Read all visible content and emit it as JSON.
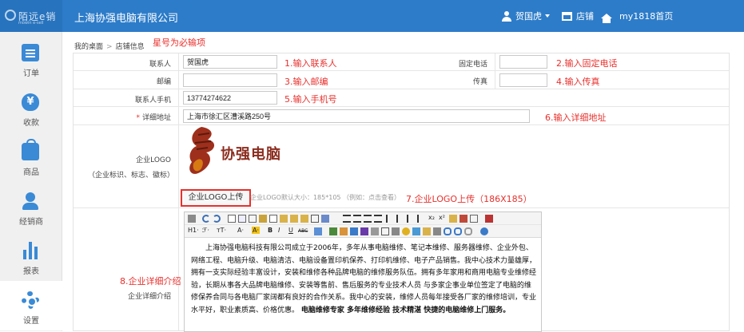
{
  "brand": {
    "logo_text": "陌远e销",
    "logo_sub": "mowin e-sell"
  },
  "header": {
    "company": "上海协强电脑有限公司",
    "user": "贺国虎",
    "store": "店铺",
    "home": "my1818首页"
  },
  "sidebar": {
    "items": [
      {
        "label": "订单",
        "icon": "order-icon"
      },
      {
        "label": "收款",
        "icon": "money-bag-icon"
      },
      {
        "label": "商品",
        "icon": "shopping-bag-icon"
      },
      {
        "label": "经销商",
        "icon": "person-icon"
      },
      {
        "label": "报表",
        "icon": "bar-chart-icon"
      },
      {
        "label": "设置",
        "icon": "gear-icon"
      }
    ]
  },
  "breadcrumb": {
    "home": "我的桌面",
    "sep": ">",
    "current": "店铺信息"
  },
  "annotations": {
    "required_note": "星号为必输项",
    "a1": "1.输入联系人",
    "a2": "2.输入固定电话",
    "a3": "3.输入邮编",
    "a4": "4.输入传真",
    "a5": "5.输入手机号",
    "a6": "6.输入详细地址",
    "a7": "7.企业LOGO上传（186X185）",
    "a8": "8.企业详细介绍"
  },
  "form": {
    "contact_label": "联系人",
    "contact_value": "贺国虎",
    "phone_label": "固定电话",
    "phone_value": "",
    "zip_label": "邮编",
    "zip_value": "",
    "fax_label": "传真",
    "fax_value": "",
    "mobile_label": "联系人手机",
    "mobile_value": "13774274622",
    "address_label": "详细地址",
    "address_value": "上海市徐汇区漕溪路250号",
    "logo_label": "企业LOGO",
    "logo_sublabel": "（企业标识、标志、徽标）",
    "logo_image_text": "协强电脑",
    "upload_button": "企业LOGO上传",
    "upload_hint": "企业LOGO默认大小：185*105 （例如：点击查看）",
    "intro_label": "企业详细介绍"
  },
  "editor": {
    "toolbar_text": [
      "H1·",
      "ℱ·",
      "тT·",
      "A·",
      "A·",
      "B",
      "I",
      "U",
      "ABC"
    ],
    "paragraph": "上海协强电脑科技有限公司成立于2006年，多年从事电脑维修、笔记本维修、服务器维修、企业外包、网络工程、电脑升级、电脑清洁、电脑设备置印机保养、打印机维修、电子产品销售。我中心技术力量雄厚，拥有一支实际经验丰富设计，安装和维修各种品牌电脑的维修服务队伍。拥有多年家用和商用电脑专业维修经验，长期从事各大品牌电脑维修、安装等售前、售后服务的专业技术人员 与多家企事业单位签定了电脑的维修保养合同与各电脑厂家阔都有良好的合作关系。我中心的安装，维修人员每年接受各厂家的维修培训，专业水平好，职业素质高、价格优惠。",
    "bold_text": "电脑维修专家 多年维修经验 技术精湛 快捷的电脑维修上门服务。"
  }
}
